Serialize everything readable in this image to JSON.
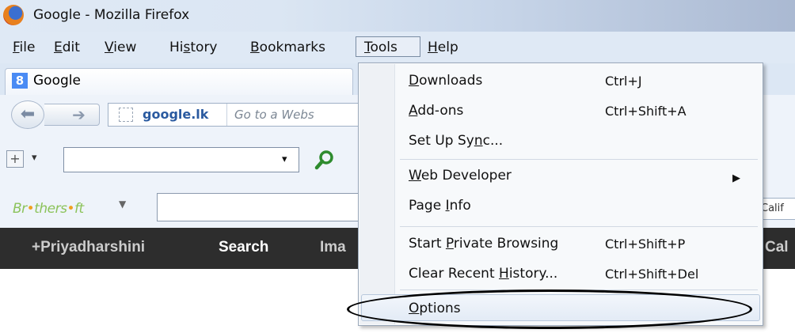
{
  "window": {
    "title": "Google - Mozilla Firefox"
  },
  "menubar": {
    "items": [
      {
        "pre": "",
        "u": "F",
        "post": "ile"
      },
      {
        "pre": "",
        "u": "E",
        "post": "dit"
      },
      {
        "pre": "",
        "u": "V",
        "post": "iew"
      },
      {
        "pre": "Hi",
        "u": "s",
        "post": "tory"
      },
      {
        "pre": "",
        "u": "B",
        "post": "ookmarks"
      },
      {
        "pre": "",
        "u": "T",
        "post": "ools"
      },
      {
        "pre": "",
        "u": "H",
        "post": "elp"
      }
    ]
  },
  "tab": {
    "label": "Google",
    "icon": "8"
  },
  "nav": {
    "url_domain": "google.lk",
    "url_placeholder": "Go to a Webs"
  },
  "toolbar1": {
    "plus": "+",
    "dropdown": "▾",
    "caret": "▾"
  },
  "toolbar2": {
    "logo_parts": [
      "Br",
      "•",
      "thers",
      "•",
      "ft"
    ],
    "caret": "▼",
    "right_input": "Calif"
  },
  "gbar": {
    "items": [
      "+Priyadharshini",
      "Search",
      "Ima",
      "Cal"
    ]
  },
  "tools_menu": {
    "items": [
      {
        "pre": "",
        "u": "D",
        "post": "ownloads",
        "shortcut": "Ctrl+J"
      },
      {
        "pre": "",
        "u": "A",
        "post": "dd-ons",
        "shortcut": "Ctrl+Shift+A"
      },
      {
        "pre": "Set Up Sy",
        "u": "n",
        "post": "c...",
        "shortcut": ""
      },
      {
        "pre": "",
        "u": "W",
        "post": "eb Developer",
        "shortcut": ""
      },
      {
        "pre": "Page ",
        "u": "I",
        "post": "nfo",
        "shortcut": ""
      },
      {
        "pre": "Start ",
        "u": "P",
        "post": "rivate Browsing",
        "shortcut": "Ctrl+Shift+P"
      },
      {
        "pre": "Clear Recent ",
        "u": "H",
        "post": "istory...",
        "shortcut": "Ctrl+Shift+Del"
      },
      {
        "pre": "",
        "u": "O",
        "post": "ptions",
        "shortcut": ""
      }
    ],
    "submenu_arrow": "▶"
  },
  "colors": {
    "gbar_bg": "#2d2d2d",
    "gbar_text": "#cccccc",
    "gbar_active": "#ffffff",
    "accent": "#2a5aa0"
  }
}
